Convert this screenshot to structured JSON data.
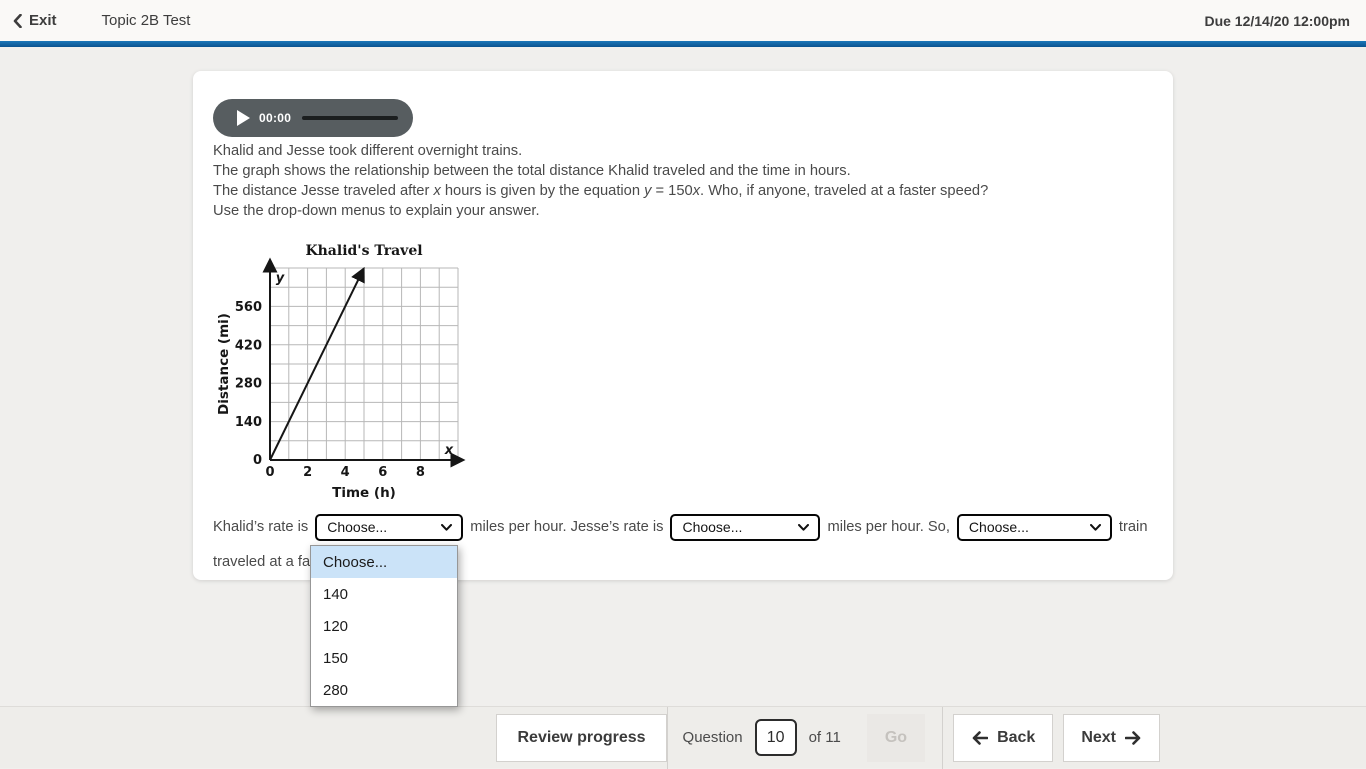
{
  "header": {
    "exit": "Exit",
    "title": "Topic 2B Test",
    "due": "Due 12/14/20 12:00pm"
  },
  "audio": {
    "elapsed": "00:00"
  },
  "question": {
    "lines": [
      [
        {
          "t": "Khalid and Jesse took different overnight trains."
        }
      ],
      [
        {
          "t": "The graph shows the relationship between the total distance Khalid traveled and the time in hours."
        }
      ],
      [
        {
          "t": "The distance Jesse traveled after "
        },
        {
          "t": "x",
          "i": 1
        },
        {
          "t": " hours is given by the equation "
        },
        {
          "t": "y",
          "i": 1
        },
        {
          "t": " = 150"
        },
        {
          "t": "x",
          "i": 1
        },
        {
          "t": ". Who, if anyone, traveled at a faster speed?"
        }
      ],
      [
        {
          "t": "Use the drop-down menus to explain your answer."
        }
      ]
    ]
  },
  "chart_data": {
    "type": "line",
    "title": "Khalid's Travel",
    "xlabel": "Time (h)",
    "ylabel": "Distance (mi)",
    "x_ticks": [
      0,
      2,
      4,
      6,
      8
    ],
    "y_ticks": [
      0,
      140,
      280,
      420,
      560
    ],
    "xlim": [
      0,
      10
    ],
    "ylim": [
      0,
      700
    ],
    "grid": true,
    "axis_end_labels": {
      "x": "x",
      "y": "y"
    },
    "series": [
      {
        "name": "Khalid",
        "points": [
          [
            0,
            0
          ],
          [
            1,
            140
          ],
          [
            2,
            280
          ],
          [
            3,
            420
          ],
          [
            4,
            560
          ],
          [
            5,
            700
          ]
        ],
        "rate_mi_per_h": 140
      }
    ]
  },
  "sentence": {
    "part1": "Khalid’s rate is",
    "select1": "Choose...",
    "part2": "miles per hour. Jesse’s rate is",
    "select2": "Choose...",
    "part3": "miles per hour. So,",
    "select3": "Choose...",
    "part4": "train",
    "line2_visible": "traveled at a fa"
  },
  "dropdown": {
    "options": [
      "Choose...",
      "140",
      "120",
      "150",
      "280"
    ],
    "selected_index": 0,
    "highlight_color": "#cbe3f8"
  },
  "footer": {
    "review": "Review progress",
    "question_label": "Question",
    "question_value": "10",
    "of_label": "of 11",
    "go": "Go",
    "back": "Back",
    "next": "Next"
  },
  "colors": {
    "accent_bar_blue": "#0d5a99",
    "page_bg": "#f0efed",
    "audio_pill": "#575d60",
    "footer_bg": "#eeedea"
  }
}
